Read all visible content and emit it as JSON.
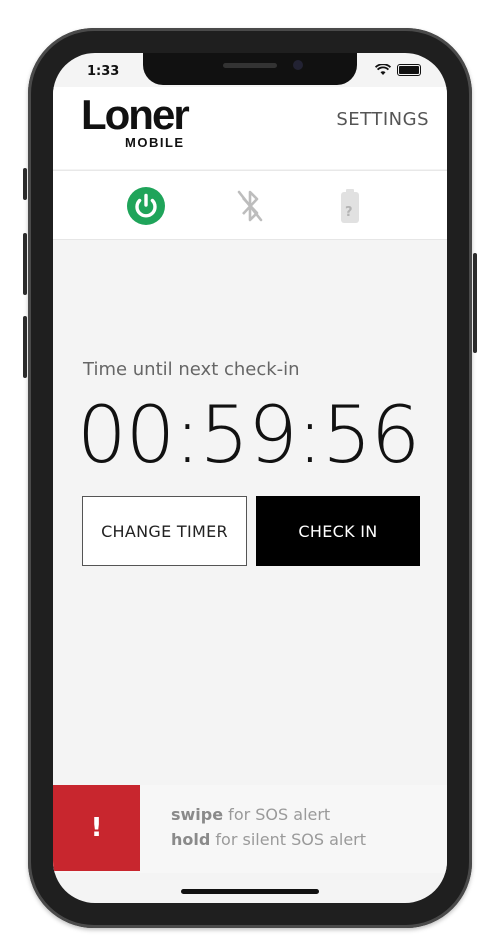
{
  "status": {
    "time": "1:33"
  },
  "header": {
    "logo_main": "Loner",
    "logo_sub": "MOBILE",
    "settings_label": "SETTINGS"
  },
  "icons": {
    "power": "power-icon",
    "bluetooth": "bluetooth-off-icon",
    "battery": "battery-unknown-icon",
    "battery_symbol": "?"
  },
  "main": {
    "label": "Time until next check-in",
    "timer": "00:59:56",
    "change_timer_label": "CHANGE TIMER",
    "check_in_label": "CHECK IN"
  },
  "sos": {
    "icon_symbol": "!",
    "swipe_word": "swipe",
    "swipe_text": " for SOS alert",
    "hold_word": "hold",
    "hold_text": " for silent SOS alert"
  },
  "colors": {
    "power_green": "#1fa45a",
    "sos_red": "#c8262e",
    "check_in_bg": "#000000"
  }
}
